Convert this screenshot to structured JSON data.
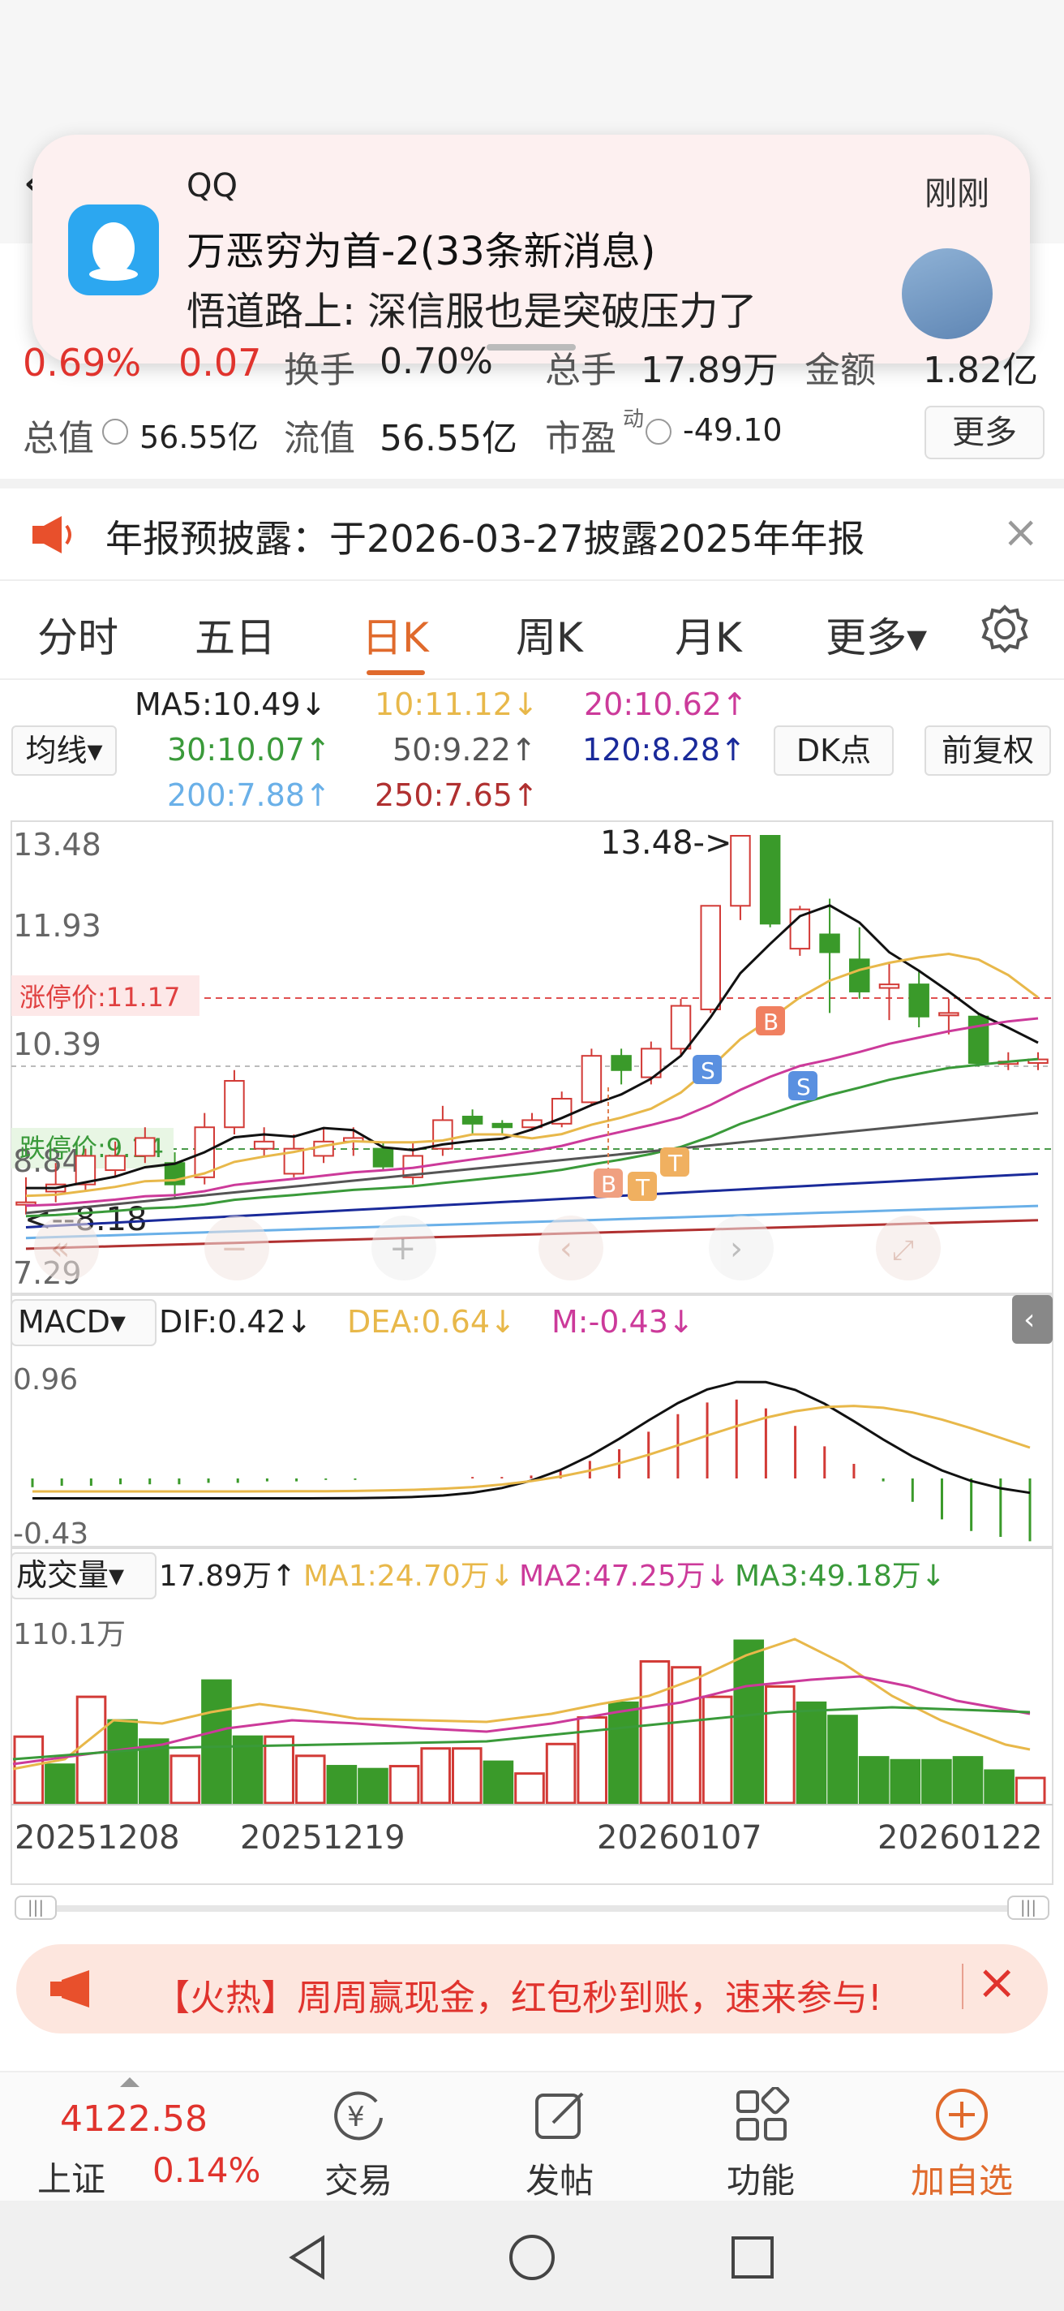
{
  "notification": {
    "app": "QQ",
    "time": "刚刚",
    "title": "万恶穷为首-2(33条新消息)",
    "body": "悟道路上: 深信服也是突破压力了"
  },
  "quote": {
    "change_pct": "0.69%",
    "change_amt": "0.07",
    "turnover_partial": "换手",
    "turnover_val": "0.70%",
    "volume_partial": "总手",
    "volume_val": "17.89万",
    "amount_partial": "金额",
    "amount_val": "1.82亿",
    "total_value_label": "总值",
    "total_value": "56.55亿",
    "float_value_label": "流值",
    "float_value": "56.55亿",
    "pe_label": "市盈",
    "pe_sup": "动",
    "pe_value": "-49.10",
    "more_label": "更多"
  },
  "notice": {
    "text": "年报预披露：于2026-03-27披露2025年年报"
  },
  "tabs": [
    {
      "label": "分时"
    },
    {
      "label": "五日"
    },
    {
      "label": "日K"
    },
    {
      "label": "周K"
    },
    {
      "label": "月K"
    },
    {
      "label": "更多▾"
    }
  ],
  "indicators": {
    "ma_select": "均线▾",
    "ma5": "MA5:10.49↓",
    "ma10": "10:11.12↓",
    "ma20": "20:10.62↑",
    "ma30": "30:10.07↑",
    "ma50": "50:9.22↑",
    "ma120": "120:8.28↑",
    "ma200": "200:7.88↑",
    "ma250": "250:7.65↑",
    "dk_button": "DK点",
    "adjust_button": "前复权"
  },
  "chart_data": {
    "type": "candlestick",
    "y_ticks": [
      "13.48",
      "11.93",
      "10.39",
      "8.84",
      "7.29"
    ],
    "limit_up_label": "涨停价:11.17",
    "limit_down_label": "跌停价:9.14",
    "high_annotation": "13.48->",
    "low_annotation": "<--8.18",
    "markers": [
      "B",
      "T",
      "T",
      "S",
      "B",
      "S"
    ],
    "x_dates": [
      "20251208",
      "20251219",
      "20260107",
      "20260122"
    ],
    "ylim": [
      7.29,
      13.48
    ],
    "candles": [
      [
        8.35,
        8.35,
        8.18,
        8.7
      ],
      [
        8.5,
        8.6,
        8.35,
        8.9
      ],
      [
        8.6,
        9.0,
        8.5,
        9.1
      ],
      [
        8.8,
        9.0,
        8.7,
        9.2
      ],
      [
        9.0,
        9.25,
        8.9,
        9.4
      ],
      [
        8.9,
        8.6,
        8.4,
        9.05
      ],
      [
        8.7,
        9.4,
        8.6,
        9.6
      ],
      [
        9.4,
        10.05,
        9.3,
        10.2
      ],
      [
        9.1,
        9.2,
        9.0,
        9.4
      ],
      [
        8.75,
        9.1,
        8.7,
        9.3
      ],
      [
        9.0,
        9.2,
        8.9,
        9.4
      ],
      [
        9.2,
        9.25,
        9.0,
        9.4
      ],
      [
        9.1,
        8.85,
        8.8,
        9.2
      ],
      [
        8.7,
        9.0,
        8.6,
        9.2
      ],
      [
        9.1,
        9.5,
        9.0,
        9.7
      ],
      [
        9.55,
        9.45,
        9.3,
        9.65
      ],
      [
        9.45,
        9.4,
        9.3,
        9.5
      ],
      [
        9.4,
        9.5,
        9.35,
        9.6
      ],
      [
        9.45,
        9.8,
        9.4,
        9.9
      ],
      [
        9.75,
        10.4,
        9.7,
        10.5
      ],
      [
        10.4,
        10.2,
        10.0,
        10.5
      ],
      [
        10.1,
        10.5,
        10.0,
        10.6
      ],
      [
        10.5,
        11.1,
        10.4,
        11.2
      ],
      [
        11.05,
        12.5,
        11.0,
        12.5
      ],
      [
        12.5,
        13.48,
        12.3,
        13.48
      ],
      [
        13.48,
        12.25,
        12.2,
        13.48
      ],
      [
        11.9,
        12.45,
        11.8,
        12.5
      ],
      [
        12.1,
        11.85,
        11.0,
        12.6
      ],
      [
        11.75,
        11.3,
        11.2,
        12.2
      ],
      [
        11.35,
        11.4,
        10.9,
        11.7
      ],
      [
        11.4,
        10.95,
        10.8,
        11.6
      ],
      [
        11.0,
        11.0,
        10.7,
        11.2
      ],
      [
        10.95,
        10.3,
        10.25,
        11.0
      ],
      [
        10.3,
        10.32,
        10.2,
        10.45
      ],
      [
        10.3,
        10.35,
        10.2,
        10.45
      ]
    ],
    "ma_lines": [
      {
        "name": "MA5",
        "color": "#111111"
      },
      {
        "name": "MA10",
        "color": "#e8b84a"
      },
      {
        "name": "MA20",
        "color": "#cc3a9a"
      },
      {
        "name": "MA30",
        "color": "#3a9a3a"
      },
      {
        "name": "MA50",
        "color": "#555555"
      },
      {
        "name": "MA120",
        "color": "#1a2a9a"
      },
      {
        "name": "MA200",
        "color": "#6ab0e8"
      },
      {
        "name": "MA250",
        "color": "#b03030"
      }
    ]
  },
  "macd": {
    "select": "MACD▾",
    "dif": "DIF:0.42↓",
    "dea": "DEA:0.64↓",
    "m": "M:-0.43↓",
    "top_tick": "0.96",
    "bottom_tick": "-0.43"
  },
  "volume": {
    "select": "成交量▾",
    "current": "17.89万↑",
    "ma1": "MA1:24.70万↓",
    "ma2": "MA2:47.25万↓",
    "ma3": "MA3:49.18万↓",
    "top_tick": "110.1万",
    "bars": [
      45,
      26,
      72,
      56,
      43,
      32,
      83,
      45,
      45,
      32,
      25,
      23,
      25,
      37,
      37,
      28,
      20,
      40,
      58,
      68,
      96,
      92,
      72,
      110,
      79,
      68,
      59,
      31,
      29,
      29,
      31,
      22,
      17
    ],
    "bar_up": [
      false,
      true,
      false,
      true,
      true,
      false,
      true,
      true,
      false,
      false,
      true,
      true,
      false,
      false,
      false,
      true,
      false,
      false,
      false,
      true,
      false,
      false,
      false,
      true,
      false,
      true,
      true,
      true,
      true,
      true,
      true,
      true,
      false
    ]
  },
  "promo": {
    "text": "【火热】周周赢现金，红包秒到账，速来参与!"
  },
  "bottom_nav": {
    "index_value": "4122.58",
    "index_name": "上证",
    "index_change": "0.14%",
    "trade": "交易",
    "post": "发帖",
    "features": "功能",
    "add_watch": "加自选"
  },
  "colors": {
    "up": "#d23a36",
    "down": "#3a9a2a",
    "accent": "#e06a2c"
  }
}
